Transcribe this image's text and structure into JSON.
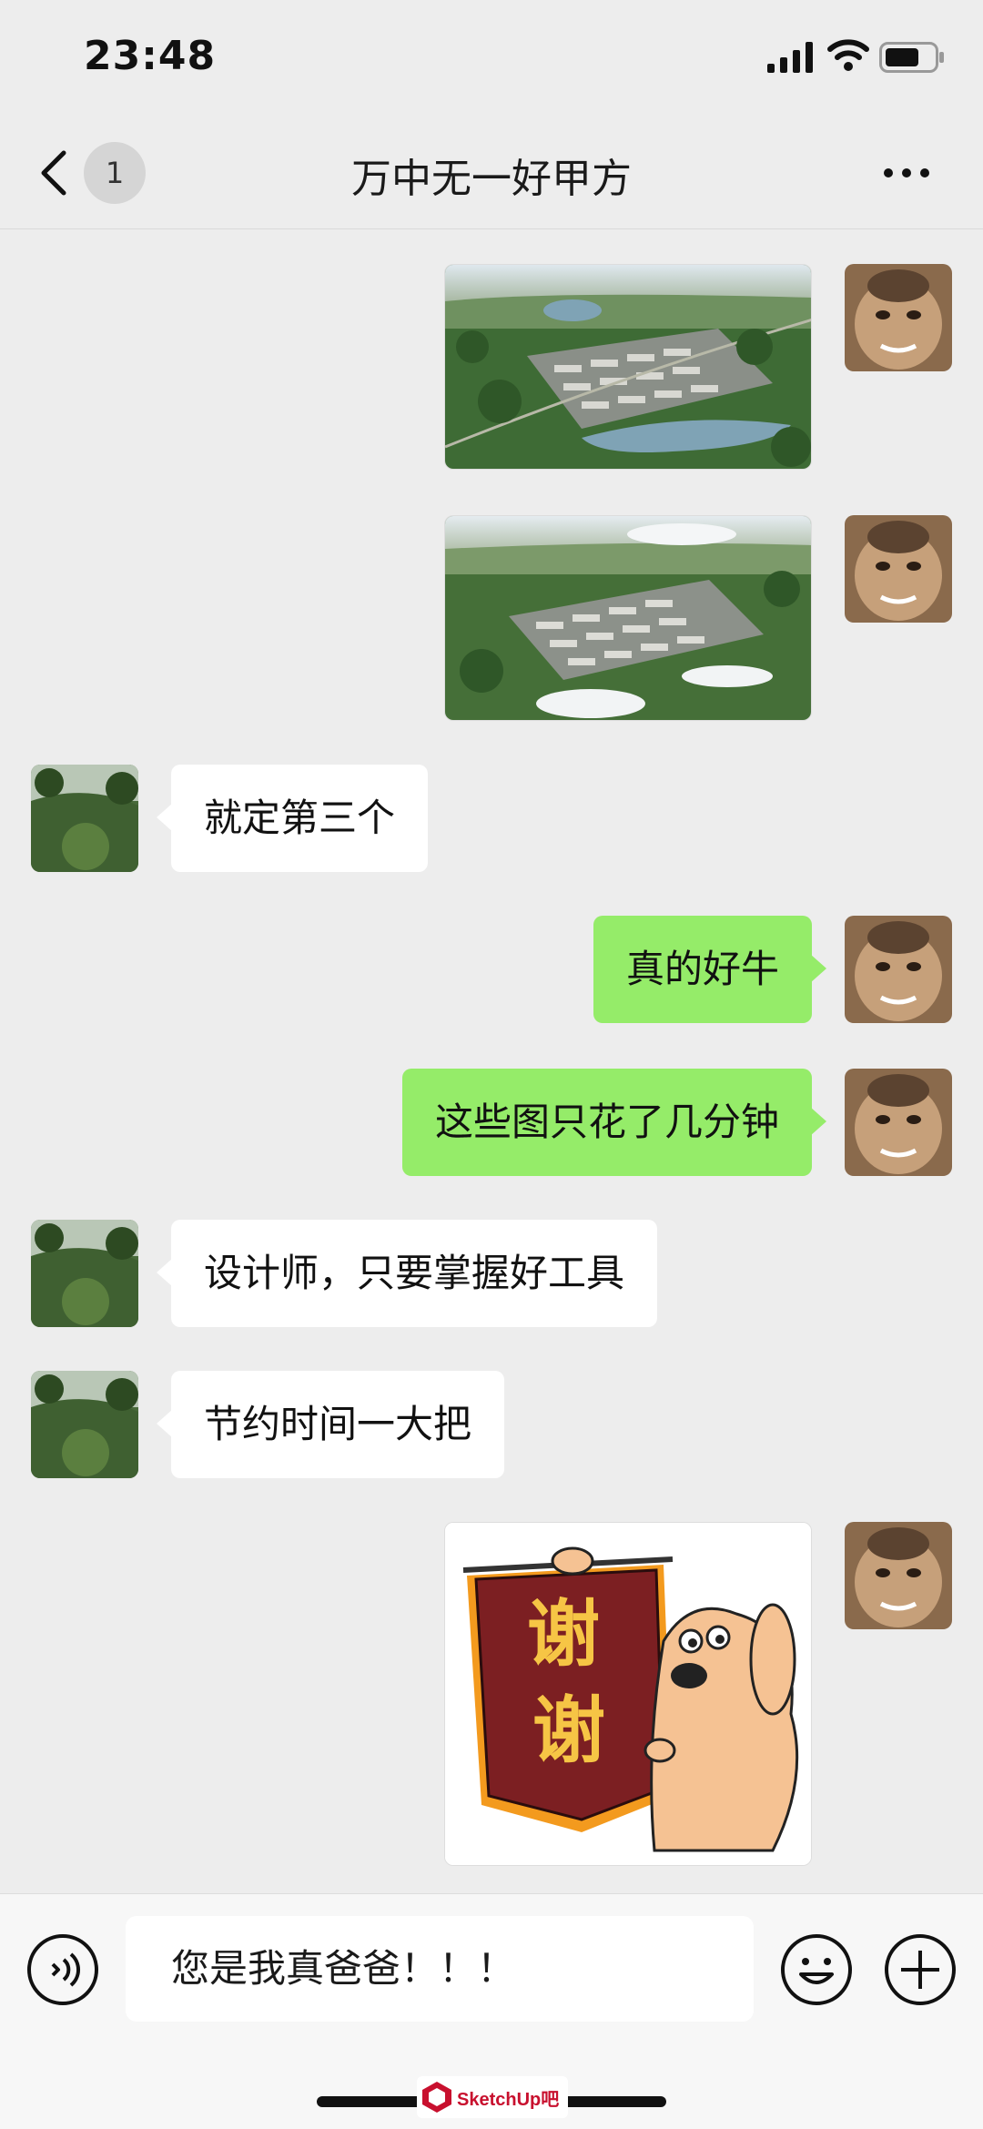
{
  "status_bar": {
    "time": "23:48"
  },
  "nav": {
    "unread_count": "1",
    "title": "万中无一好甲方"
  },
  "messages": [
    {
      "side": "me",
      "type": "image",
      "description": "aerial rendering 1"
    },
    {
      "side": "me",
      "type": "image",
      "description": "aerial rendering 2"
    },
    {
      "side": "other",
      "type": "text",
      "text": "就定第三个"
    },
    {
      "side": "me",
      "type": "text",
      "text": "真的好牛"
    },
    {
      "side": "me",
      "type": "text",
      "text": "这些图只花了几分钟"
    },
    {
      "side": "other",
      "type": "text",
      "text": "设计师，只要掌握好工具"
    },
    {
      "side": "other",
      "type": "text",
      "text": "节约时间一大把"
    },
    {
      "side": "me",
      "type": "sticker",
      "text_line1": "谢",
      "text_line2": "谢"
    }
  ],
  "input": {
    "value": "您是我真爸爸！！！"
  },
  "watermark": {
    "text": "SketchUp吧"
  },
  "colors": {
    "self_bubble": "#95ec69",
    "other_bubble": "#ffffff",
    "background": "#ededed"
  }
}
